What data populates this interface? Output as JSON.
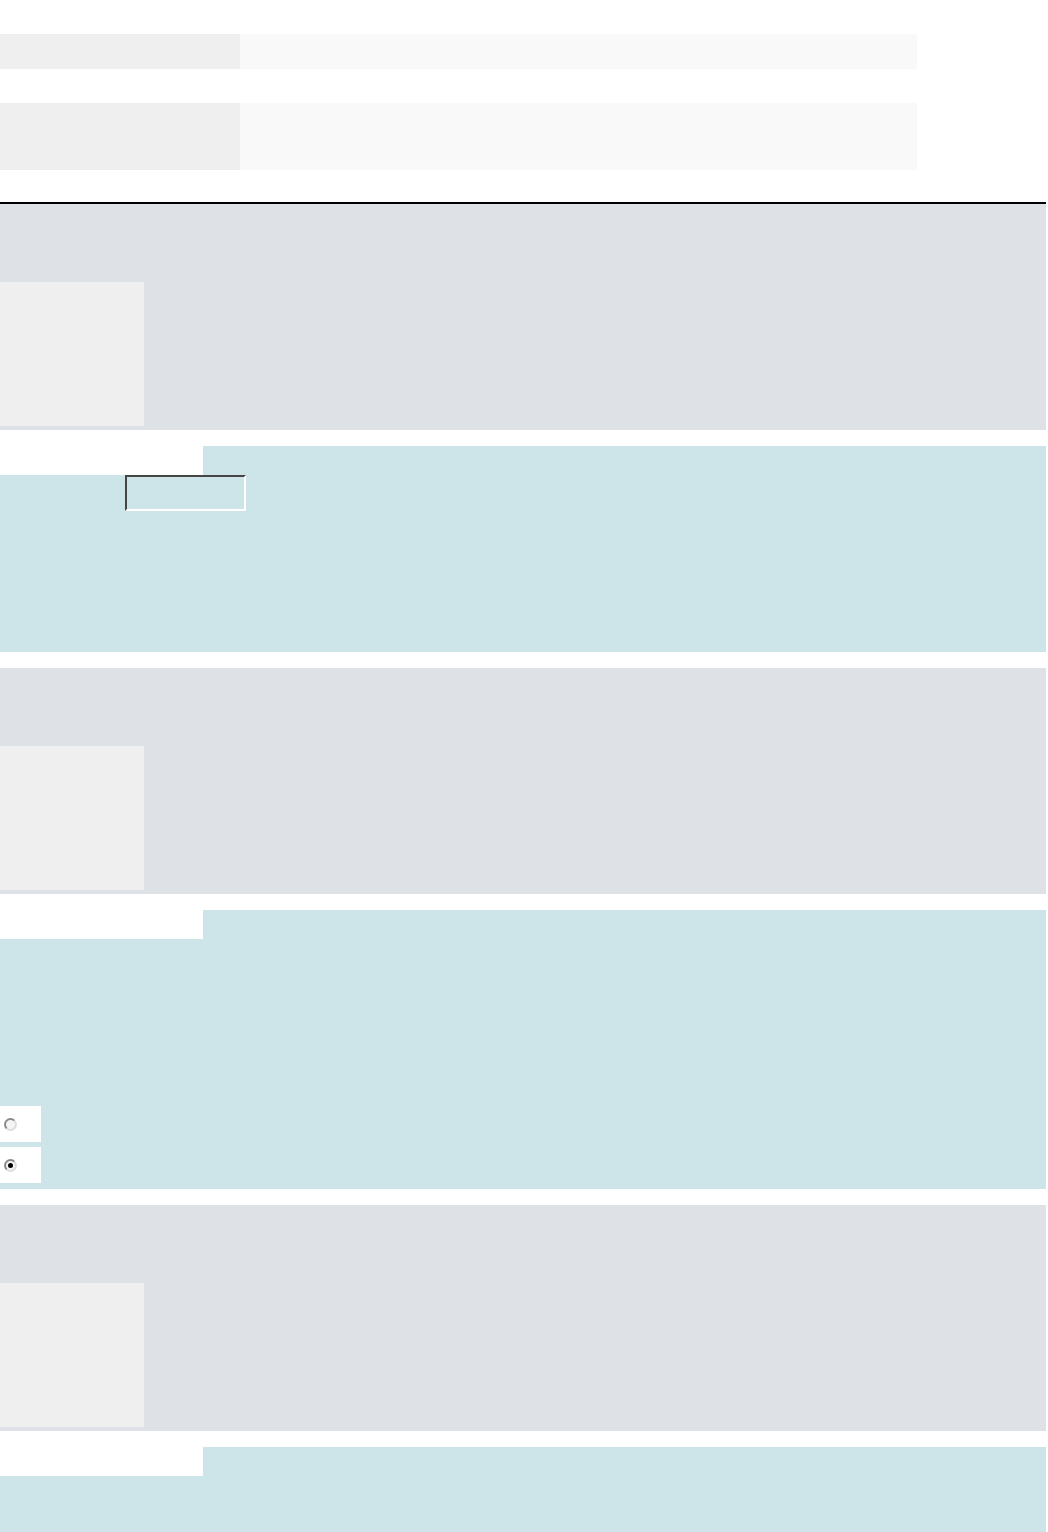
{
  "header_rows": [
    {
      "kind": "single"
    },
    {
      "kind": "tall"
    }
  ],
  "sections": [
    {
      "kind": "question"
    },
    {
      "kind": "text_answer"
    },
    {
      "kind": "question"
    },
    {
      "kind": "choice_answer",
      "options": [
        {
          "selected": false
        },
        {
          "selected": true
        }
      ]
    },
    {
      "kind": "question"
    },
    {
      "kind": "open_answer"
    }
  ]
}
